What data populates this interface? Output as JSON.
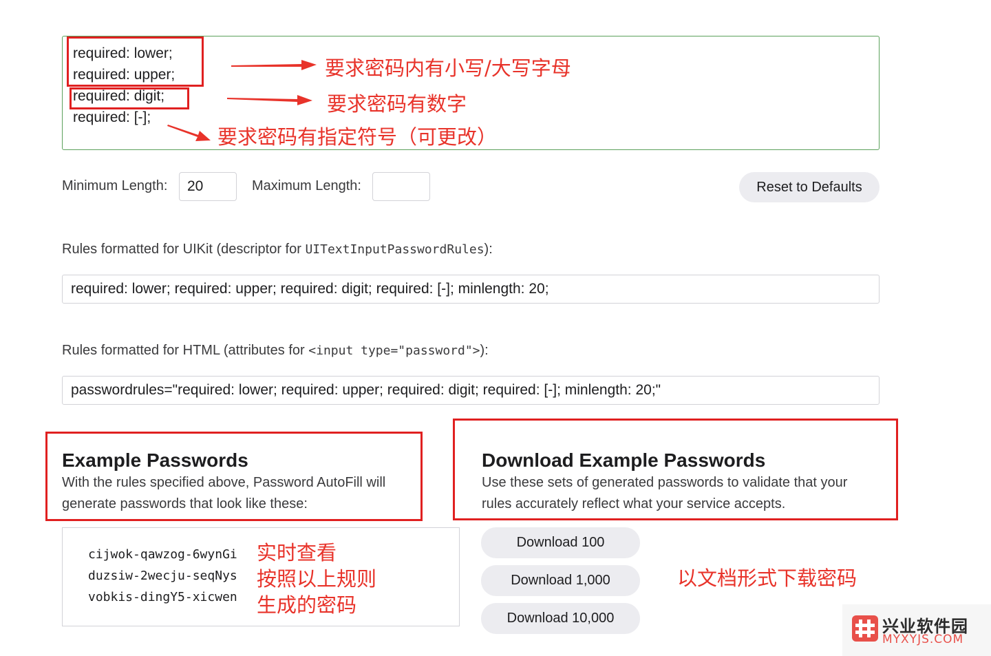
{
  "rules_editor": {
    "lines": [
      "required: lower;",
      "required: upper;",
      "required: digit;",
      "required: [-];"
    ]
  },
  "annotations": {
    "case_note": "要求密码内有小写/大写字母",
    "digit_note": "要求密码有数字",
    "symbol_note": "要求密码有指定符号（可更改）",
    "realtime_note_lines": [
      "实时查看",
      "按照以上规则",
      "生成的密码"
    ],
    "download_note": "以文档形式下载密码",
    "accent_color": "#e8332a"
  },
  "length": {
    "min_label": "Minimum Length:",
    "min_value": "20",
    "max_label": "Maximum Length:",
    "max_value": "",
    "reset_label": "Reset to Defaults"
  },
  "uikit": {
    "label_prefix": "Rules formatted for UIKit (descriptor for ",
    "label_code": "UITextInputPasswordRules",
    "label_suffix": "):",
    "value": "required: lower; required: upper; required: digit; required: [-]; minlength: 20;"
  },
  "html_rules": {
    "label_prefix": "Rules formatted for HTML (attributes for ",
    "label_code": "<input type=\"password\">",
    "label_suffix": "):",
    "value": "passwordrules=\"required: lower; required: upper; required: digit; required: [-]; minlength: 20;\""
  },
  "examples": {
    "title": "Example Passwords",
    "desc_lines": [
      "With the rules specified above, Password AutoFill will",
      "generate passwords that look like these:"
    ],
    "passwords": [
      "cijwok-qawzog-6wynGi",
      "duzsiw-2wecju-seqNys",
      "vobkis-dingY5-xicwen"
    ]
  },
  "downloads": {
    "title": "Download Example Passwords",
    "desc_lines": [
      "Use these sets of generated passwords to validate that your",
      "rules accurately reflect what your service accepts."
    ],
    "buttons": [
      "Download 100",
      "Download 1,000",
      "Download 10,000"
    ]
  },
  "watermark": {
    "cn": "兴业软件园",
    "en": "MYXYJS.COM"
  }
}
